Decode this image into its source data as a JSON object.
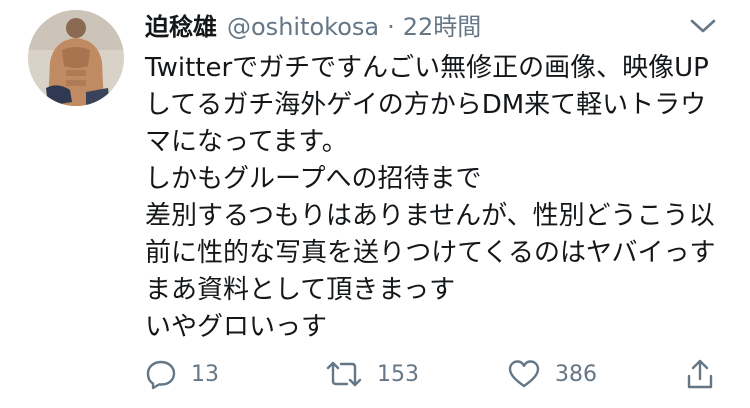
{
  "user": {
    "display_name": "迫稔雄",
    "handle": "@oshitokosa",
    "separator": "·",
    "timestamp": "22時間"
  },
  "tweet": {
    "lines": [
      "Twitterでガチですんごい無修正の画像、映像UP",
      "してるガチ海外ゲイの方からDM来て軽いトラウ",
      "マになってます。",
      "しかもグループへの招待まで",
      "差別するつもりはありませんが、性別どうこう以",
      "前に性的な写真を送りつけてくるのはヤバイっす",
      "まあ資料として頂きまっす",
      "いやグロいっす"
    ]
  },
  "actions": {
    "reply_count": "13",
    "retweet_count": "153",
    "like_count": "386"
  },
  "colors": {
    "text": "#14171a",
    "secondary": "#657786"
  },
  "icons": [
    "chevron-down-icon",
    "reply-icon",
    "retweet-icon",
    "like-icon",
    "share-icon"
  ]
}
